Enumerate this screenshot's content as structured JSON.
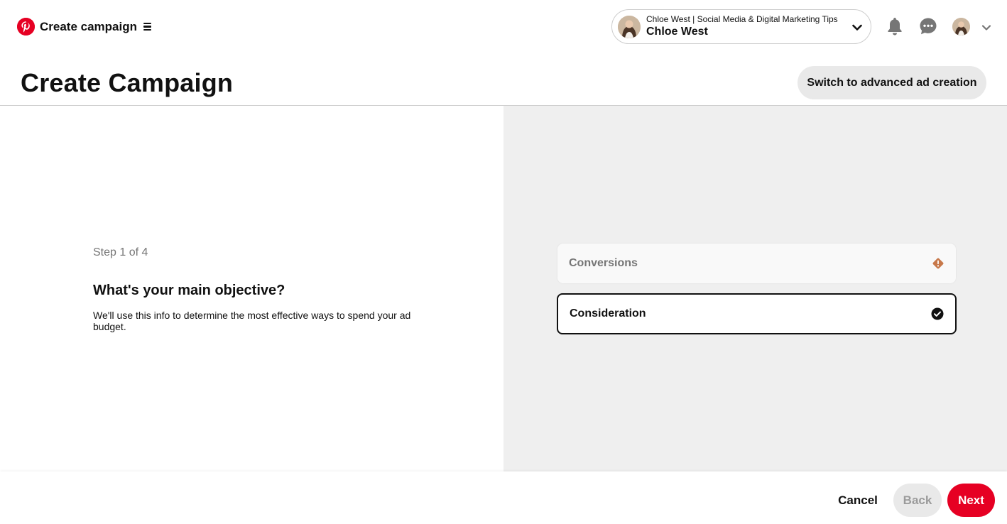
{
  "app": {
    "title": "Create campaign"
  },
  "account": {
    "business_name": "Chloe West | Social Media & Digital Marketing Tips",
    "user_name": "Chloe West"
  },
  "header": {
    "page_title": "Create Campaign",
    "advanced_button": "Switch to advanced ad creation"
  },
  "left": {
    "step": "Step 1 of 4",
    "question": "What's your main objective?",
    "help_text": "We'll use this info to determine the most effective ways to spend your ad budget."
  },
  "objectives": [
    {
      "label": "Conversions",
      "state": "disabled",
      "icon": "warning-icon"
    },
    {
      "label": "Consideration",
      "state": "selected",
      "icon": "check-circle-icon"
    }
  ],
  "footer": {
    "cancel": "Cancel",
    "back": "Back",
    "next": "Next"
  },
  "colors": {
    "brand_red": "#e60023",
    "warning_orange": "#c7784a",
    "panel_gray": "#efefef"
  }
}
